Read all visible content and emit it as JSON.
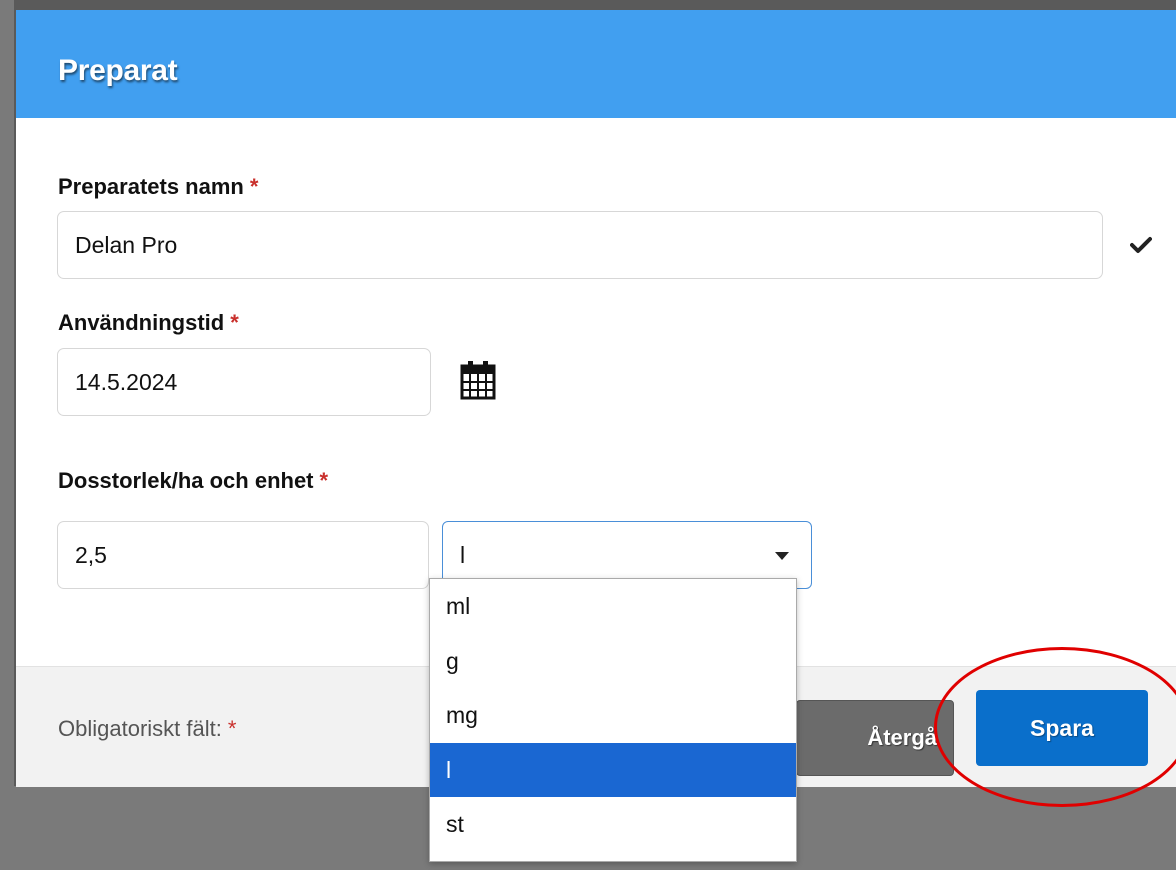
{
  "dialog": {
    "title": "Preparat"
  },
  "fields": {
    "name": {
      "label": "Preparatets namn",
      "required_mark": "*",
      "value": "Delan Pro"
    },
    "date": {
      "label": "Användningstid",
      "required_mark": "*",
      "value": "14.5.2024"
    },
    "dose": {
      "label": "Dosstorlek/ha och enhet",
      "required_mark": "*",
      "value": "2,5",
      "unit_selected": "l",
      "unit_options": [
        "ml",
        "g",
        "mg",
        "l",
        "st"
      ]
    }
  },
  "footer": {
    "required_note": "Obligatoriskt fält:",
    "required_mark": "*",
    "back_label": "Återgå",
    "save_label": "Spara"
  },
  "icons": {
    "valid": "checkmark-icon",
    "calendar": "calendar-icon",
    "dropdown": "caret-down-icon"
  },
  "colors": {
    "header": "#419ff0",
    "save_button": "#0a6fcb",
    "back_button": "#6b6b6b",
    "selected_option": "#1a67d2",
    "required": "#c9302c",
    "annotation": "#e00000"
  }
}
